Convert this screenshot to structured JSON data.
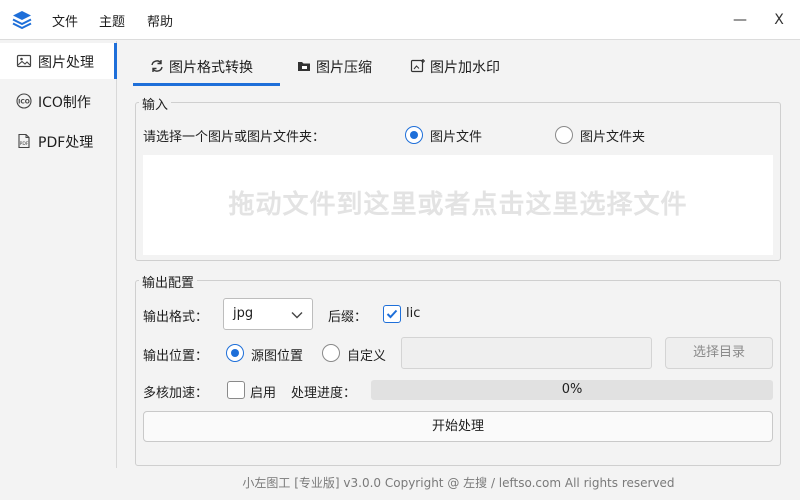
{
  "titlebar": {
    "menu": [
      "文件",
      "主题",
      "帮助"
    ],
    "minimize_label": "—",
    "close_label": "X"
  },
  "sidebar": {
    "items": [
      {
        "label": "图片处理",
        "icon": "image-icon",
        "active": true
      },
      {
        "label": "ICO制作",
        "icon": "ico-icon",
        "active": false
      },
      {
        "label": "PDF处理",
        "icon": "pdf-icon",
        "active": false
      }
    ]
  },
  "tabs": [
    {
      "label": "图片格式转换",
      "icon": "convert-icon",
      "active": true
    },
    {
      "label": "图片压缩",
      "icon": "zip-icon",
      "active": false
    },
    {
      "label": "图片加水印",
      "icon": "watermark-icon",
      "active": false
    }
  ],
  "input_group": {
    "title": "输入",
    "prompt": "请选择一个图片或图片文件夹：",
    "options": [
      {
        "label": "图片文件",
        "checked": true
      },
      {
        "label": "图片文件夹",
        "checked": false
      }
    ],
    "dropzone_text": "拖动文件到这里或者点击这里选择文件"
  },
  "output_group": {
    "title": "输出配置",
    "format_label": "输出格式：",
    "format_value": "jpg",
    "suffix_label": "后缀：",
    "suffix_checkbox_label": "lic",
    "suffix_checked": true,
    "location_label": "输出位置：",
    "location_options": [
      {
        "label": "源图位置",
        "checked": true
      },
      {
        "label": "自定义",
        "checked": false
      }
    ],
    "custom_path_value": "",
    "choose_dir_label": "选择目录",
    "multicore_label": "多核加速：",
    "multicore_checkbox_label": "启用",
    "multicore_checked": false,
    "progress_label": "处理进度：",
    "progress_text": "0%",
    "progress_value": 0,
    "start_label": "开始处理"
  },
  "footer": {
    "text": "小左图工 [专业版]  v3.0.0 Copyright @ 左搜 / leftso.com All rights reserved"
  },
  "colors": {
    "accent": "#1e6fd9",
    "background": "#f3f3f3"
  }
}
